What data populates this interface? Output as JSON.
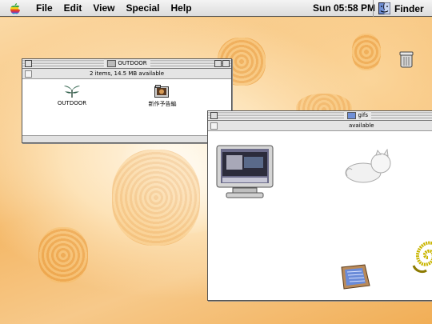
{
  "menubar": {
    "menus": [
      "File",
      "Edit",
      "View",
      "Special",
      "Help"
    ],
    "clock": "Sun 05:58 PM",
    "app_name": "Finder"
  },
  "desktop": {
    "trash_icon": "trash-icon"
  },
  "window_outdoor": {
    "title": "OUTDOOR",
    "info": "2 items, 14.5 MB available",
    "items": [
      {
        "label": "OUTDOOR",
        "icon": "plant-icon"
      },
      {
        "label": "新作予告編",
        "icon": "movie-folder-icon"
      }
    ]
  },
  "window_gifs": {
    "title": "gifs",
    "info": "available",
    "items": [
      {
        "icon": "computer-monitor-icon"
      },
      {
        "icon": "cat-figure-icon"
      },
      {
        "icon": "spiral-icon"
      },
      {
        "icon": "tv-set-icon"
      }
    ]
  }
}
